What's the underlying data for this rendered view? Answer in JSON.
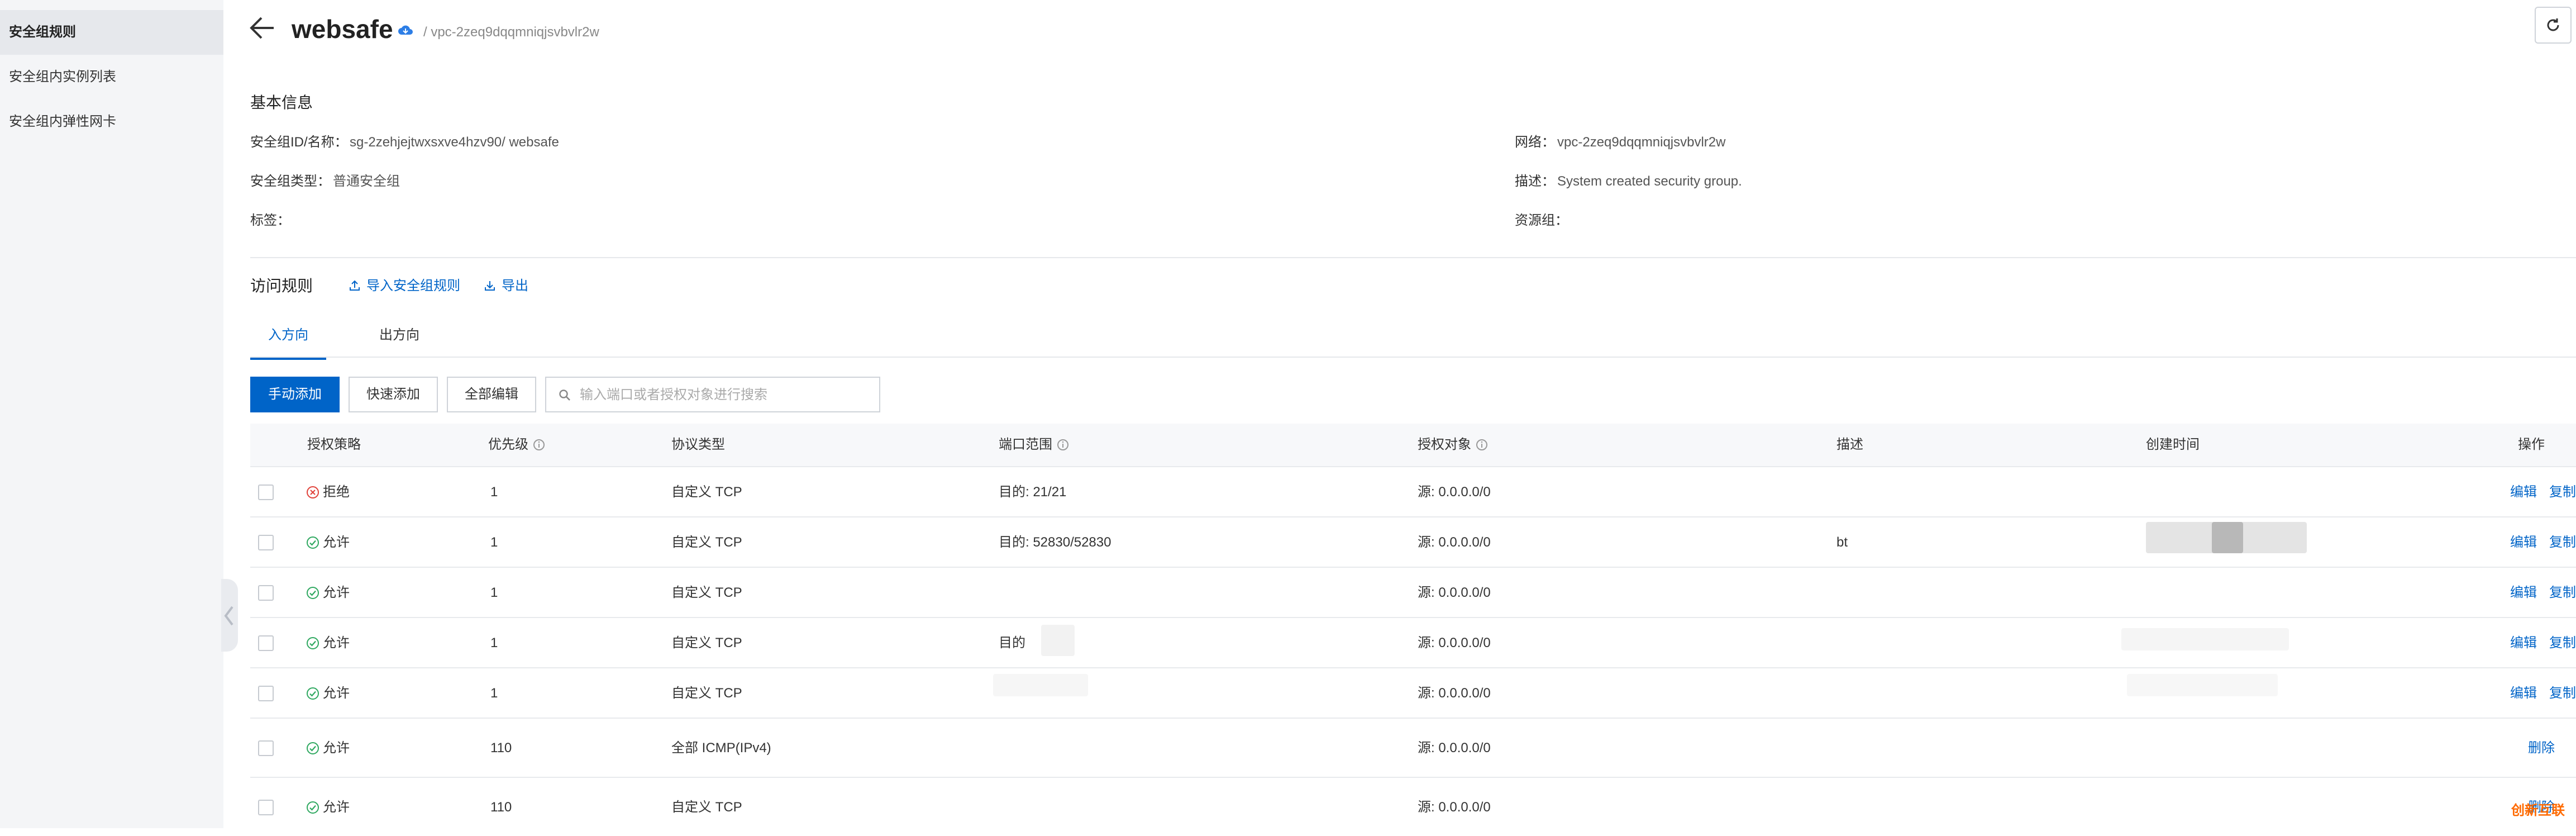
{
  "sidebar": {
    "items": [
      {
        "label": "安全组规则",
        "active": true
      },
      {
        "label": "安全组内实例列表",
        "active": false
      },
      {
        "label": "安全组内弹性网卡",
        "active": false
      }
    ]
  },
  "header": {
    "title": "websafe",
    "breadcrumb": "/ vpc-2zeq9dqqmniqjsvbvlr2w"
  },
  "basic_info": {
    "section_title": "基本信息",
    "fields": {
      "id_name": {
        "label": "安全组ID/名称：",
        "value": "sg-2zehjejtwxsxve4hzv90/ websafe"
      },
      "type": {
        "label": "安全组类型：",
        "value": "普通安全组"
      },
      "tags": {
        "label": "标签：",
        "value": ""
      },
      "network": {
        "label": "网络：",
        "value": "vpc-2zeq9dqqmniqjsvbvlr2w"
      },
      "description": {
        "label": "描述：",
        "value": "System created security group."
      },
      "resource_group": {
        "label": "资源组：",
        "value": ""
      }
    }
  },
  "rules": {
    "section_title": "访问规则",
    "import_label": "导入安全组规则",
    "export_label": "导出",
    "tabs": [
      {
        "label": "入方向",
        "active": true
      },
      {
        "label": "出方向",
        "active": false
      }
    ],
    "toolbar": {
      "manual_add": "手动添加",
      "quick_add": "快速添加",
      "edit_all": "全部编辑",
      "search_placeholder": "输入端口或者授权对象进行搜索"
    },
    "columns": [
      "授权策略",
      "优先级",
      "协议类型",
      "端口范围",
      "授权对象",
      "描述",
      "创建时间",
      "操作"
    ],
    "rows": [
      {
        "policy": "拒绝",
        "policy_type": "deny",
        "priority": "1",
        "protocol": "自定义 TCP",
        "port": "目的: 21/21",
        "source": "源: 0.0.0.0/0",
        "desc": "",
        "actions": [
          "编辑",
          "复制"
        ]
      },
      {
        "policy": "允许",
        "policy_type": "allow",
        "priority": "1",
        "protocol": "自定义 TCP",
        "port": "目的: 52830/52830",
        "source": "源: 0.0.0.0/0",
        "desc": "bt",
        "actions": [
          "编辑",
          "复制"
        ]
      },
      {
        "policy": "允许",
        "policy_type": "allow",
        "priority": "1",
        "protocol": "自定义 TCP",
        "port": "",
        "source": "源: 0.0.0.0/0",
        "desc": "",
        "actions": [
          "编辑",
          "复制"
        ]
      },
      {
        "policy": "允许",
        "policy_type": "allow",
        "priority": "1",
        "protocol": "自定义 TCP",
        "port": "目的",
        "source": "源: 0.0.0.0/0",
        "desc": "",
        "actions": [
          "编辑",
          "复制"
        ]
      },
      {
        "policy": "允许",
        "policy_type": "allow",
        "priority": "1",
        "protocol": "自定义 TCP",
        "port": "",
        "source": "源: 0.0.0.0/0",
        "desc": "",
        "actions": [
          "编辑",
          "复制"
        ]
      },
      {
        "policy": "允许",
        "policy_type": "allow",
        "priority": "110",
        "protocol": "全部 ICMP(IPv4)",
        "port": "",
        "source": "源: 0.0.0.0/0",
        "desc": "",
        "actions": [
          "删除"
        ]
      },
      {
        "policy": "允许",
        "policy_type": "allow",
        "priority": "110",
        "protocol": "自定义 TCP",
        "port": "",
        "source": "源: 0.0.0.0/0",
        "desc": "",
        "actions": [
          "删除"
        ]
      }
    ]
  },
  "watermark": "创新互联",
  "colors": {
    "accent": "#0064c8",
    "deny": "#e0423a",
    "allow": "#2fa860",
    "sidebar_bg": "#f4f5f7",
    "header_bg": "#f7f8fa"
  }
}
